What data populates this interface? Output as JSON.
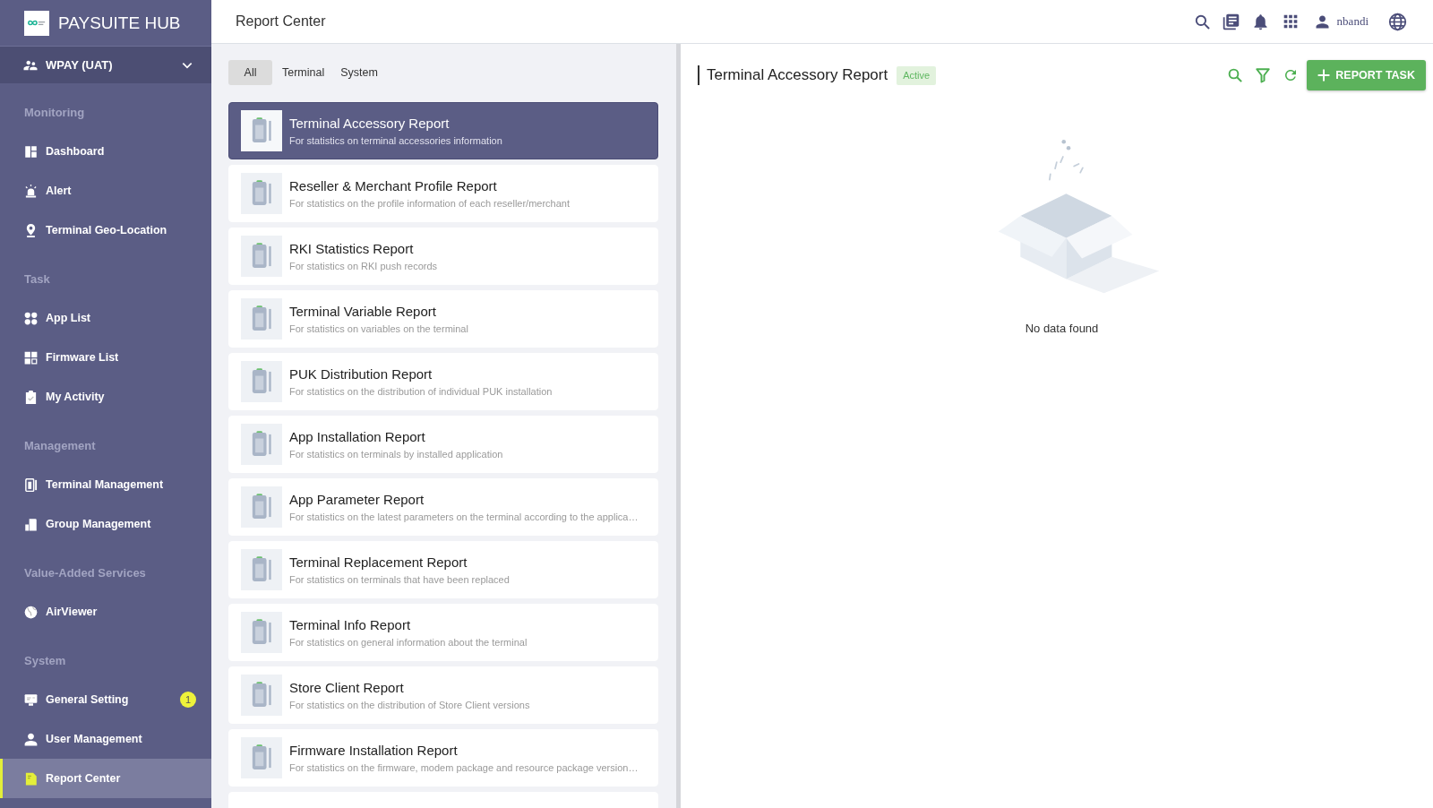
{
  "sidebar": {
    "brand": "PAYSUITE HUB",
    "org": "WPAY (UAT)",
    "sections": [
      {
        "heading": "Monitoring",
        "items": [
          {
            "label": "Dashboard",
            "kind": "dashboard",
            "selected": false
          },
          {
            "label": "Alert",
            "kind": "alert",
            "selected": false
          },
          {
            "label": "Terminal Geo-Location",
            "kind": "geo",
            "selected": false
          }
        ]
      },
      {
        "heading": "Task",
        "items": [
          {
            "label": "App List",
            "kind": "apps",
            "selected": false
          },
          {
            "label": "Firmware List",
            "kind": "firmware",
            "selected": false
          },
          {
            "label": "My Activity",
            "kind": "activity",
            "selected": false
          }
        ]
      },
      {
        "heading": "Management",
        "items": [
          {
            "label": "Terminal Management",
            "kind": "terminal",
            "selected": false
          },
          {
            "label": "Group Management",
            "kind": "group",
            "selected": false
          }
        ]
      },
      {
        "heading": "Value-Added Services",
        "items": [
          {
            "label": "AirViewer",
            "kind": "airviewer",
            "selected": false
          }
        ]
      },
      {
        "heading": "System",
        "items": [
          {
            "label": "General Setting",
            "kind": "setting",
            "selected": false,
            "badge": "1"
          },
          {
            "label": "User Management",
            "kind": "user",
            "selected": false
          },
          {
            "label": "Report Center",
            "kind": "report",
            "selected": true
          }
        ]
      }
    ]
  },
  "header": {
    "title": "Report Center",
    "user": "nbandi"
  },
  "filters": [
    {
      "label": "All",
      "selected": true
    },
    {
      "label": "Terminal",
      "selected": false
    },
    {
      "label": "System",
      "selected": false
    }
  ],
  "reports": [
    {
      "title": "Terminal Accessory Report",
      "description": "For statistics on terminal accessories information",
      "selected": true
    },
    {
      "title": "Reseller & Merchant Profile Report",
      "description": "For statistics on the profile information of each reseller/merchant",
      "selected": false
    },
    {
      "title": "RKI Statistics Report",
      "description": "For statistics on RKI push records",
      "selected": false
    },
    {
      "title": "Terminal Variable Report",
      "description": "For statistics on variables on the terminal",
      "selected": false
    },
    {
      "title": "PUK Distribution Report",
      "description": "For statistics on the distribution of individual PUK installation",
      "selected": false
    },
    {
      "title": "App Installation Report",
      "description": "For statistics on terminals by installed application",
      "selected": false
    },
    {
      "title": "App Parameter Report",
      "description": "For statistics on the latest parameters on the terminal according to the applica…",
      "selected": false
    },
    {
      "title": "Terminal Replacement Report",
      "description": "For statistics on terminals that have been replaced",
      "selected": false
    },
    {
      "title": "Terminal Info Report",
      "description": "For statistics on general information about the terminal",
      "selected": false
    },
    {
      "title": "Store Client Report",
      "description": "For statistics on the distribution of Store Client versions",
      "selected": false
    },
    {
      "title": "Firmware Installation Report",
      "description": "For statistics on the firmware, modem package and resource package version…",
      "selected": false
    }
  ],
  "detail": {
    "title": "Terminal Accessory Report",
    "status": "Active",
    "button": "REPORT TASK",
    "empty_text": "No data found"
  }
}
